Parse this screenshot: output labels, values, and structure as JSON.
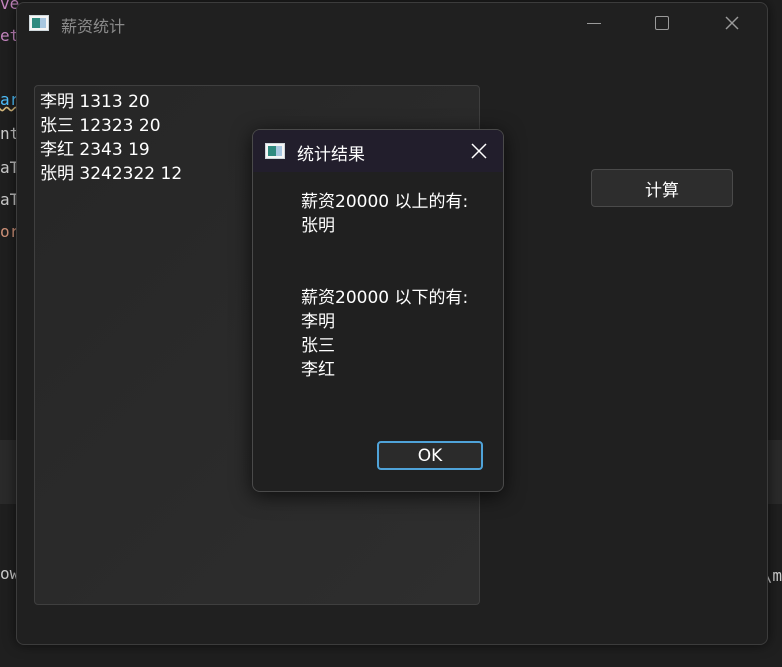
{
  "background": {
    "editor_fragments": [
      {
        "text": "ve",
        "color": "#c586c0"
      },
      {
        "text": "et",
        "color": "#c586c0"
      },
      {
        "text": "ar",
        "color": "#4fc1ff"
      },
      {
        "text": "nt",
        "color": "#cccccc"
      },
      {
        "text": "aT",
        "color": "#cccccc"
      },
      {
        "text": "aT",
        "color": "#cccccc"
      },
      {
        "text": "or",
        "color": "#ce9178"
      }
    ],
    "left_bottom_text": "ow",
    "right_bottom_text": "\\m"
  },
  "window": {
    "title": "薪资统计",
    "icon": "app-window-icon",
    "controls": {
      "minimize_icon": "minimize-icon",
      "maximize_icon": "maximize-icon",
      "close_icon": "close-icon"
    }
  },
  "input_area": {
    "lines": [
      "李明 1313 20",
      "张三 12323 20",
      "李红 2343 19",
      "张明 3242322 12"
    ]
  },
  "calculate_button": {
    "label": "计算"
  },
  "dialog": {
    "title": "统计结果",
    "icon": "app-window-icon",
    "close_icon": "close-icon",
    "message_lines": [
      "薪资20000 以上的有:",
      "张明",
      "",
      "",
      "薪资20000 以下的有:",
      "李明",
      "张三",
      "李红"
    ],
    "ok_label": "OK"
  },
  "colors": {
    "window_bg": "#202020",
    "dialog_title_bg": "#221e2c",
    "ok_focus_border": "#4fa3d9",
    "text": "#ffffff"
  }
}
